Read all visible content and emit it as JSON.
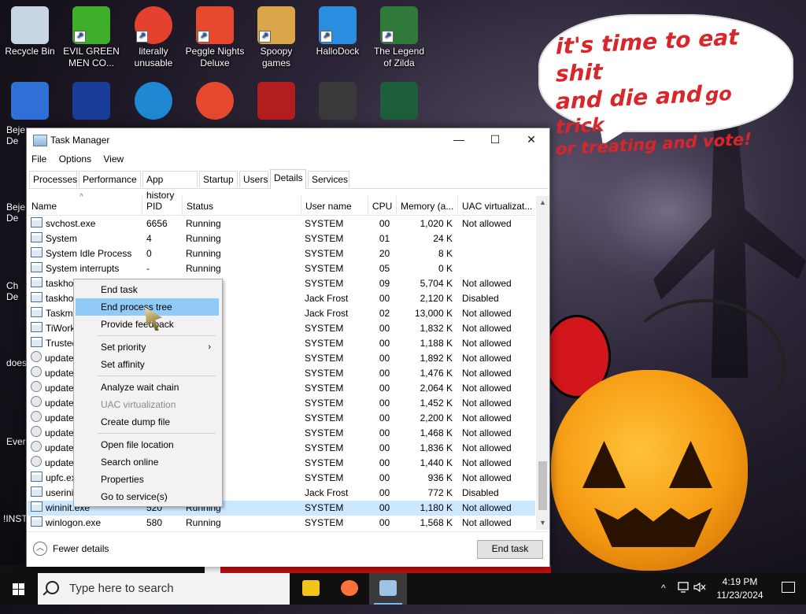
{
  "desktop": {
    "icons_row1": [
      {
        "label": "Recycle Bin",
        "icon": "recycle-bin-icon",
        "color": "#c7d6e2"
      },
      {
        "label": "EVIL GREEN MEN CO...",
        "icon": "green-men-icon",
        "color": "#3fae2a"
      },
      {
        "label": "literally unusable",
        "icon": "chrome-icon",
        "color": "#e5412f"
      },
      {
        "label": "Peggle Nights Deluxe",
        "icon": "peggle-icon",
        "color": "#e6492d"
      },
      {
        "label": "Spoopy games",
        "icon": "folder-icon",
        "color": "#d9a74a"
      },
      {
        "label": "HalloDock",
        "icon": "windows-icon",
        "color": "#2b8de0"
      },
      {
        "label": "The Legend of Zilda",
        "icon": "zilda-icon",
        "color": "#2f7a3a"
      }
    ],
    "icons_row2": [
      {
        "icon": "bejeweled-icon",
        "color": "#2f6fd6"
      },
      {
        "icon": "mpl-icon",
        "color": "#1b3d9a"
      },
      {
        "icon": "edge-icon",
        "color": "#1e88d3"
      },
      {
        "icon": "peggle-icon",
        "color": "#e6492d"
      },
      {
        "icon": "flash-icon",
        "color": "#b31d1d"
      },
      {
        "icon": "remote-icon",
        "color": "#3a3a3a"
      },
      {
        "icon": "yashma-icon",
        "color": "#1d5f3a"
      }
    ],
    "partial_labels": [
      "Beje",
      "De",
      "Beje",
      "De",
      "Ch",
      "De",
      "does",
      "Ever",
      "!INST"
    ],
    "speech_bubble": {
      "line1": "it's time to eat shit",
      "line2a": "and die and",
      "line2b": "go trick",
      "line3": "or treating and vote!"
    }
  },
  "task_manager": {
    "title": "Task Manager",
    "window_buttons": {
      "minimize": "—",
      "maximize": "☐",
      "close": "✕"
    },
    "menu": [
      "File",
      "Options",
      "View"
    ],
    "tabs": [
      "Processes",
      "Performance",
      "App history",
      "Startup",
      "Users",
      "Details",
      "Services"
    ],
    "active_tab": "Details",
    "columns": [
      "Name",
      "PID",
      "Status",
      "User name",
      "CPU",
      "Memory (a...",
      "UAC virtualizat..."
    ],
    "rows": [
      {
        "name": "svchost.exe",
        "pid": "6656",
        "status": "Running",
        "user": "SYSTEM",
        "cpu": "00",
        "mem": "1,020 K",
        "uac": "Not allowed"
      },
      {
        "name": "System",
        "pid": "4",
        "status": "Running",
        "user": "SYSTEM",
        "cpu": "01",
        "mem": "24 K",
        "uac": ""
      },
      {
        "name": "System Idle Process",
        "pid": "0",
        "status": "Running",
        "user": "SYSTEM",
        "cpu": "20",
        "mem": "8 K",
        "uac": ""
      },
      {
        "name": "System interrupts",
        "pid": "-",
        "status": "Running",
        "user": "SYSTEM",
        "cpu": "05",
        "mem": "0 K",
        "uac": ""
      },
      {
        "name": "taskhos",
        "pid": "",
        "status": "",
        "user": "SYSTEM",
        "cpu": "09",
        "mem": "5,704 K",
        "uac": "Not allowed"
      },
      {
        "name": "taskhos",
        "pid": "",
        "status": "",
        "user": "Jack Frost",
        "cpu": "00",
        "mem": "2,120 K",
        "uac": "Disabled"
      },
      {
        "name": "Taskmg",
        "pid": "",
        "status": "",
        "user": "Jack Frost",
        "cpu": "02",
        "mem": "13,000 K",
        "uac": "Not allowed"
      },
      {
        "name": "TiWork",
        "pid": "",
        "status": "",
        "user": "SYSTEM",
        "cpu": "00",
        "mem": "1,832 K",
        "uac": "Not allowed"
      },
      {
        "name": "Trusted",
        "pid": "",
        "status": "",
        "user": "SYSTEM",
        "cpu": "00",
        "mem": "1,188 K",
        "uac": "Not allowed"
      },
      {
        "name": "update",
        "pid": "",
        "status": "",
        "user": "SYSTEM",
        "cpu": "00",
        "mem": "1,892 K",
        "uac": "Not allowed"
      },
      {
        "name": "update",
        "pid": "",
        "status": "",
        "user": "SYSTEM",
        "cpu": "00",
        "mem": "1,476 K",
        "uac": "Not allowed"
      },
      {
        "name": "update",
        "pid": "",
        "status": "",
        "user": "SYSTEM",
        "cpu": "00",
        "mem": "2,064 K",
        "uac": "Not allowed"
      },
      {
        "name": "update",
        "pid": "",
        "status": "",
        "user": "SYSTEM",
        "cpu": "00",
        "mem": "1,452 K",
        "uac": "Not allowed"
      },
      {
        "name": "update",
        "pid": "",
        "status": "",
        "user": "SYSTEM",
        "cpu": "00",
        "mem": "2,200 K",
        "uac": "Not allowed"
      },
      {
        "name": "update",
        "pid": "",
        "status": "",
        "user": "SYSTEM",
        "cpu": "00",
        "mem": "1,468 K",
        "uac": "Not allowed"
      },
      {
        "name": "update",
        "pid": "",
        "status": "",
        "user": "SYSTEM",
        "cpu": "00",
        "mem": "1,836 K",
        "uac": "Not allowed"
      },
      {
        "name": "update",
        "pid": "",
        "status": "",
        "user": "SYSTEM",
        "cpu": "00",
        "mem": "1,440 K",
        "uac": "Not allowed"
      },
      {
        "name": "upfc.ex",
        "pid": "",
        "status": "",
        "user": "SYSTEM",
        "cpu": "00",
        "mem": "936 K",
        "uac": "Not allowed"
      },
      {
        "name": "userinit",
        "pid": "",
        "status": "",
        "user": "Jack Frost",
        "cpu": "00",
        "mem": "772 K",
        "uac": "Disabled"
      },
      {
        "name": "wininit.exe",
        "pid": "520",
        "status": "Running",
        "user": "SYSTEM",
        "cpu": "00",
        "mem": "1,180 K",
        "uac": "Not allowed",
        "selected": true
      },
      {
        "name": "winlogon.exe",
        "pid": "580",
        "status": "Running",
        "user": "SYSTEM",
        "cpu": "00",
        "mem": "1,568 K",
        "uac": "Not allowed"
      }
    ],
    "footer": {
      "fewer_details": "Fewer details",
      "end_task": "End task"
    }
  },
  "context_menu": {
    "items": [
      {
        "label": "End task",
        "group": 0
      },
      {
        "label": "End process tree",
        "group": 0,
        "highlighted": true
      },
      {
        "label": "Provide feedback",
        "group": 0
      },
      {
        "label": "Set priority",
        "group": 1,
        "submenu": true
      },
      {
        "label": "Set affinity",
        "group": 1
      },
      {
        "label": "Analyze wait chain",
        "group": 2
      },
      {
        "label": "UAC virtualization",
        "group": 2,
        "disabled": true
      },
      {
        "label": "Create dump file",
        "group": 2
      },
      {
        "label": "Open file location",
        "group": 3
      },
      {
        "label": "Search online",
        "group": 3
      },
      {
        "label": "Properties",
        "group": 3
      },
      {
        "label": "Go to service(s)",
        "group": 3
      }
    ],
    "submenu_arrow": "›"
  },
  "taskbar": {
    "search_placeholder": "Type here to search",
    "apps": [
      {
        "icon": "file-explorer-icon",
        "color": "#f0c419"
      },
      {
        "icon": "firefox-icon",
        "color": "#ff7139"
      },
      {
        "icon": "task-manager-icon",
        "color": "#9fc3e6",
        "active": true
      }
    ],
    "tray": {
      "chevron": "^",
      "time": "4:19 PM",
      "date": "11/23/2024"
    }
  }
}
